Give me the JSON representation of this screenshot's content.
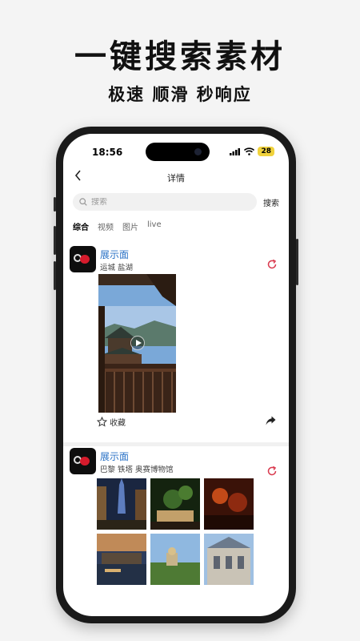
{
  "promo": {
    "title": "一键搜索素材",
    "subtitle": "极速 顺滑 秒响应"
  },
  "status_bar": {
    "time": "18:56",
    "battery": "28"
  },
  "navbar": {
    "title": "详情"
  },
  "search": {
    "placeholder": "搜索",
    "button": "搜索"
  },
  "tabs": [
    "综合",
    "视频",
    "图片",
    "live"
  ],
  "posts": [
    {
      "name": "展示面",
      "location": "运城 盐湖",
      "favorite_label": "收藏",
      "type": "video"
    },
    {
      "name": "展示面",
      "location": "巴黎 铁塔 奥赛博物馆",
      "type": "images"
    }
  ],
  "colors": {
    "accent_name": "#2a72c6",
    "refresh_icon": "#d9394e",
    "battery": "#f0d23c"
  },
  "icons": {
    "back": "chevron-left-icon",
    "search": "search-icon",
    "refresh": "refresh-icon",
    "favorite": "star-icon",
    "share": "share-icon"
  }
}
